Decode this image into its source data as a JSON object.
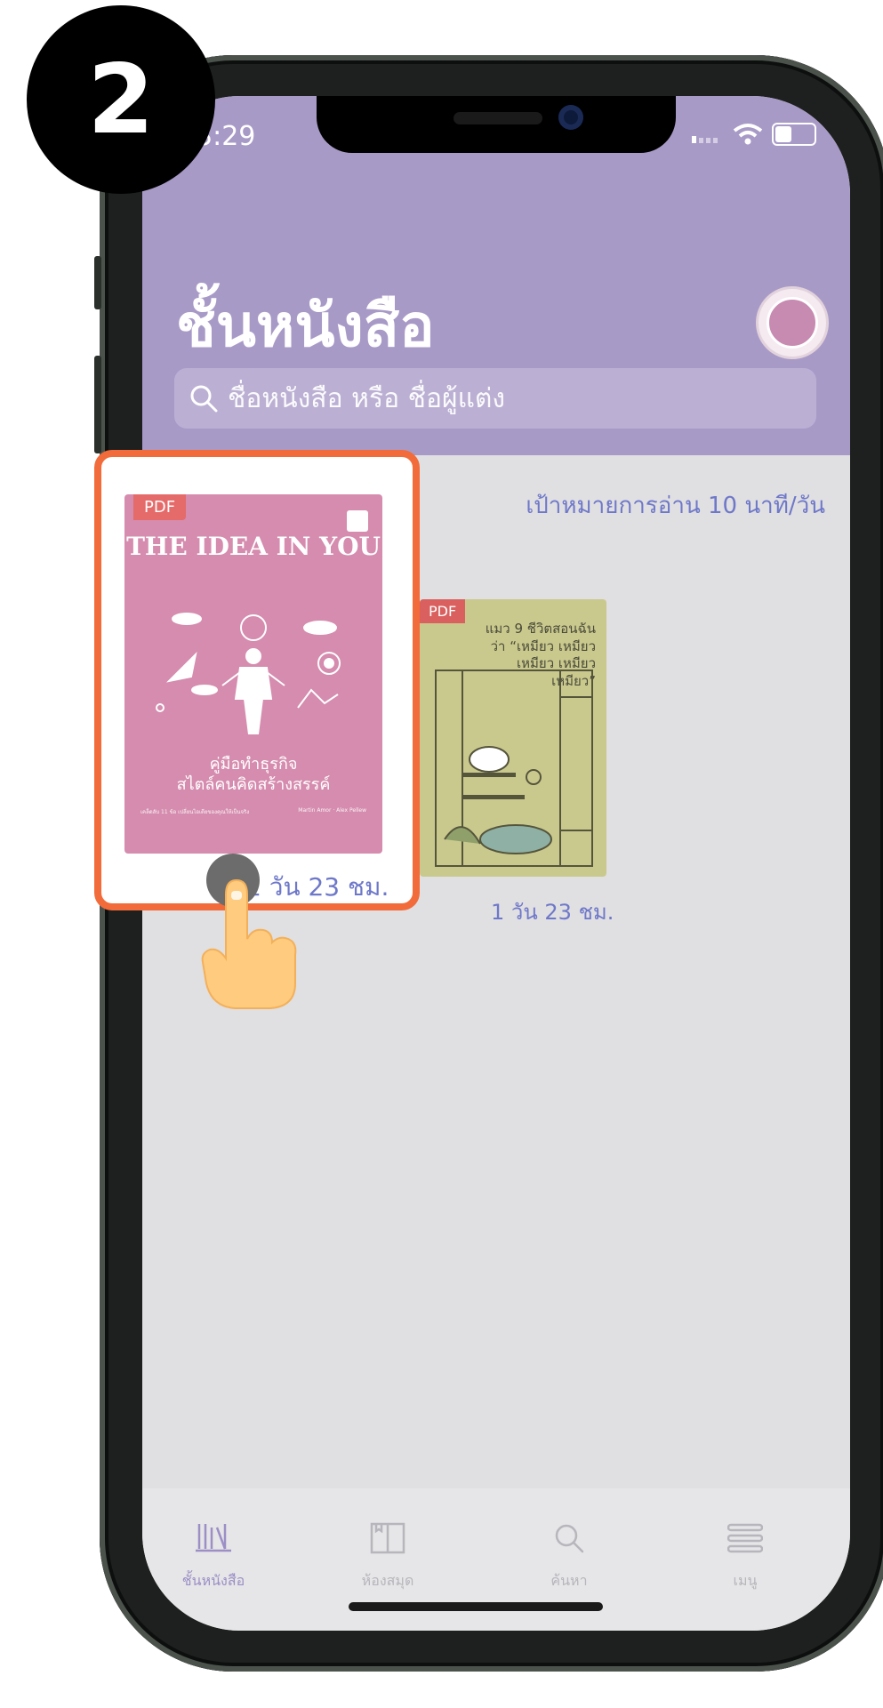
{
  "step": {
    "number": "2"
  },
  "status_bar": {
    "time": "3:29"
  },
  "header": {
    "title": "ชั้นหนังสือ",
    "search_placeholder": "ชื่อหนังสือ หรือ ชื่อผู้แต่ง"
  },
  "reading_goal": "เป้าหมายการอ่าน 10 นาที/วัน",
  "books": [
    {
      "format": "PDF",
      "title_en": "THE IDEA IN YOU",
      "title_th_line1": "คู่มือทำธุรกิจ",
      "title_th_line2": "สไตล์คนคิดสร้างสรรค์",
      "footer_left": "เคล็ดลับ 11 ข้อ เปลี่ยนไอเดียของคุณให้เป็นจริง",
      "footer_right": "Martin Amor · Alex Pellew",
      "time_left": "1 วัน 23 ชม."
    },
    {
      "format": "PDF",
      "title": "แมว 9 ชีวิตสอนฉันว่า “เหมียว เหมียว เหมียว เหมียว เหมียว”",
      "time_left": "1 วัน 23 ชม."
    }
  ],
  "tabbar": {
    "items": [
      {
        "label": "ชั้นหนังสือ",
        "icon": "bookshelf-icon",
        "active": true
      },
      {
        "label": "ห้องสมุด",
        "icon": "library-icon",
        "active": false
      },
      {
        "label": "ค้นหา",
        "icon": "search-icon",
        "active": false
      },
      {
        "label": "เมนู",
        "icon": "menu-icon",
        "active": false
      }
    ]
  },
  "colors": {
    "header": "#a89ac7",
    "accent": "#6e78c9",
    "highlight": "#f26b3a",
    "book1_cover": "#d58cae",
    "book2_cover": "#c9c98e"
  }
}
